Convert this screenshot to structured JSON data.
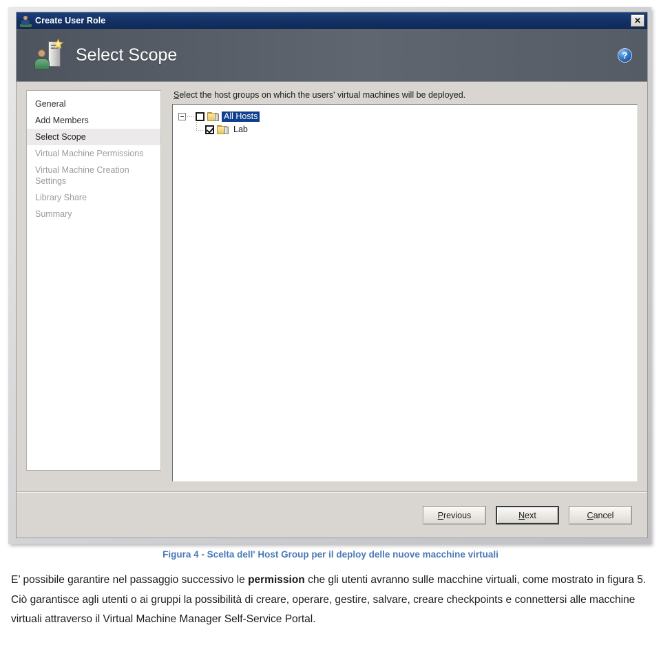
{
  "window": {
    "title": "Create User Role",
    "close_label": "✕",
    "titlebar_icon": "user-role-icon"
  },
  "banner": {
    "heading": "Select Scope",
    "icon": "user-server-new-icon",
    "help_label": "?"
  },
  "sidebar": {
    "items": [
      {
        "label": "General",
        "state": "visited"
      },
      {
        "label": "Add Members",
        "state": "visited"
      },
      {
        "label": "Select Scope",
        "state": "active"
      },
      {
        "label": "Virtual Machine Permissions",
        "state": "disabled"
      },
      {
        "label": "Virtual Machine Creation\nSettings",
        "state": "disabled"
      },
      {
        "label": "Library Share",
        "state": "disabled"
      },
      {
        "label": "Summary",
        "state": "disabled"
      }
    ]
  },
  "main": {
    "instruction_accel": "S",
    "instruction_rest": "elect the host groups on which the users' virtual machines will be deployed.",
    "tree": {
      "root": {
        "label": "All Hosts",
        "checked": false,
        "selected": true,
        "expanded": true,
        "icon": "host-group-folder-icon"
      },
      "children": [
        {
          "label": "Lab",
          "checked": true,
          "selected": false,
          "icon": "host-group-folder-icon"
        }
      ]
    }
  },
  "footer": {
    "buttons": [
      {
        "accel": "P",
        "rest": "revious",
        "default": false
      },
      {
        "accel": "N",
        "rest": "ext",
        "default": true
      },
      {
        "accel": "C",
        "rest": "ancel",
        "default": false
      }
    ]
  },
  "document": {
    "figure_caption": "Figura 4 - Scelta dell' Host Group per il deploy delle nuove macchine virtuali",
    "paragraph": {
      "part1": "E’ possibile garantire nel passaggio successivo le ",
      "bold": "permission",
      "part2": " che gli utenti avranno sulle macchine virtuali, come mostrato in figura 5. Ciò garantisce agli utenti o ai gruppi la possibilità di creare, operare, gestire, salvare, creare checkpoints e connettersi alle macchine virtuali attraverso il Virtual Machine Manager Self-Service Portal."
    }
  }
}
